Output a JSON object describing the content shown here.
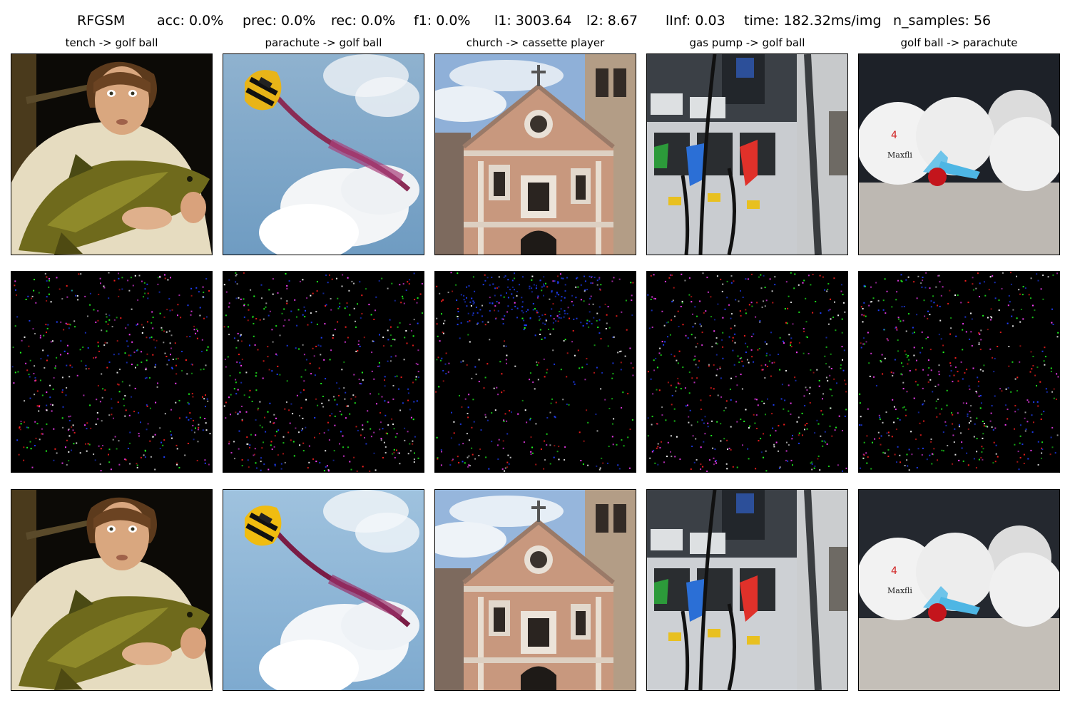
{
  "figure": {
    "suptitle": {
      "method": "RFGSM",
      "acc": "acc: 0.0%",
      "prec": "prec: 0.0%",
      "rec": "rec: 0.0%",
      "f1": "f1: 0.0%",
      "l1": "l1: 3003.64",
      "l2": "l2: 8.67",
      "linf": "lInf: 0.03",
      "time": "time: 182.32ms/img",
      "n_samples": "n_samples: 56"
    },
    "columns": [
      {
        "title": "tench -> golf ball",
        "scene": "man-holding-tench-fish"
      },
      {
        "title": "parachute -> golf ball",
        "scene": "yellow-parachute-with-smoke-trail-in-sky"
      },
      {
        "title": "church -> cassette player",
        "scene": "old-stone-church-facade"
      },
      {
        "title": "gas pump -> golf ball",
        "scene": "gas-station-fuel-pump-nozzles"
      },
      {
        "title": "golf ball -> parachute",
        "scene": "golf-balls-with-tees"
      }
    ],
    "rows": [
      "original-image",
      "adversarial-perturbation",
      "adversarial-image"
    ],
    "colors": {
      "perturbation_bg": "#000000",
      "noise_red": "#ff2020",
      "noise_green": "#20ff20",
      "noise_blue": "#2040ff"
    }
  }
}
